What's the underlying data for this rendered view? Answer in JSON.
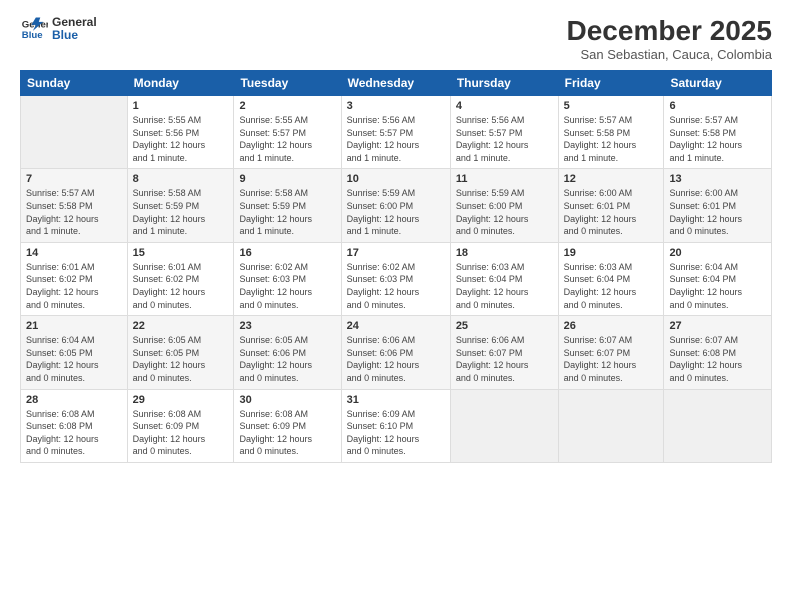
{
  "header": {
    "logo_line1": "General",
    "logo_line2": "Blue",
    "month": "December 2025",
    "location": "San Sebastian, Cauca, Colombia"
  },
  "weekdays": [
    "Sunday",
    "Monday",
    "Tuesday",
    "Wednesday",
    "Thursday",
    "Friday",
    "Saturday"
  ],
  "weeks": [
    [
      {
        "day": "",
        "info": ""
      },
      {
        "day": "1",
        "info": "Sunrise: 5:55 AM\nSunset: 5:56 PM\nDaylight: 12 hours\nand 1 minute."
      },
      {
        "day": "2",
        "info": "Sunrise: 5:55 AM\nSunset: 5:57 PM\nDaylight: 12 hours\nand 1 minute."
      },
      {
        "day": "3",
        "info": "Sunrise: 5:56 AM\nSunset: 5:57 PM\nDaylight: 12 hours\nand 1 minute."
      },
      {
        "day": "4",
        "info": "Sunrise: 5:56 AM\nSunset: 5:57 PM\nDaylight: 12 hours\nand 1 minute."
      },
      {
        "day": "5",
        "info": "Sunrise: 5:57 AM\nSunset: 5:58 PM\nDaylight: 12 hours\nand 1 minute."
      },
      {
        "day": "6",
        "info": "Sunrise: 5:57 AM\nSunset: 5:58 PM\nDaylight: 12 hours\nand 1 minute."
      }
    ],
    [
      {
        "day": "7",
        "info": "Sunrise: 5:57 AM\nSunset: 5:58 PM\nDaylight: 12 hours\nand 1 minute."
      },
      {
        "day": "8",
        "info": "Sunrise: 5:58 AM\nSunset: 5:59 PM\nDaylight: 12 hours\nand 1 minute."
      },
      {
        "day": "9",
        "info": "Sunrise: 5:58 AM\nSunset: 5:59 PM\nDaylight: 12 hours\nand 1 minute."
      },
      {
        "day": "10",
        "info": "Sunrise: 5:59 AM\nSunset: 6:00 PM\nDaylight: 12 hours\nand 1 minute."
      },
      {
        "day": "11",
        "info": "Sunrise: 5:59 AM\nSunset: 6:00 PM\nDaylight: 12 hours\nand 0 minutes."
      },
      {
        "day": "12",
        "info": "Sunrise: 6:00 AM\nSunset: 6:01 PM\nDaylight: 12 hours\nand 0 minutes."
      },
      {
        "day": "13",
        "info": "Sunrise: 6:00 AM\nSunset: 6:01 PM\nDaylight: 12 hours\nand 0 minutes."
      }
    ],
    [
      {
        "day": "14",
        "info": "Sunrise: 6:01 AM\nSunset: 6:02 PM\nDaylight: 12 hours\nand 0 minutes."
      },
      {
        "day": "15",
        "info": "Sunrise: 6:01 AM\nSunset: 6:02 PM\nDaylight: 12 hours\nand 0 minutes."
      },
      {
        "day": "16",
        "info": "Sunrise: 6:02 AM\nSunset: 6:03 PM\nDaylight: 12 hours\nand 0 minutes."
      },
      {
        "day": "17",
        "info": "Sunrise: 6:02 AM\nSunset: 6:03 PM\nDaylight: 12 hours\nand 0 minutes."
      },
      {
        "day": "18",
        "info": "Sunrise: 6:03 AM\nSunset: 6:04 PM\nDaylight: 12 hours\nand 0 minutes."
      },
      {
        "day": "19",
        "info": "Sunrise: 6:03 AM\nSunset: 6:04 PM\nDaylight: 12 hours\nand 0 minutes."
      },
      {
        "day": "20",
        "info": "Sunrise: 6:04 AM\nSunset: 6:04 PM\nDaylight: 12 hours\nand 0 minutes."
      }
    ],
    [
      {
        "day": "21",
        "info": "Sunrise: 6:04 AM\nSunset: 6:05 PM\nDaylight: 12 hours\nand 0 minutes."
      },
      {
        "day": "22",
        "info": "Sunrise: 6:05 AM\nSunset: 6:05 PM\nDaylight: 12 hours\nand 0 minutes."
      },
      {
        "day": "23",
        "info": "Sunrise: 6:05 AM\nSunset: 6:06 PM\nDaylight: 12 hours\nand 0 minutes."
      },
      {
        "day": "24",
        "info": "Sunrise: 6:06 AM\nSunset: 6:06 PM\nDaylight: 12 hours\nand 0 minutes."
      },
      {
        "day": "25",
        "info": "Sunrise: 6:06 AM\nSunset: 6:07 PM\nDaylight: 12 hours\nand 0 minutes."
      },
      {
        "day": "26",
        "info": "Sunrise: 6:07 AM\nSunset: 6:07 PM\nDaylight: 12 hours\nand 0 minutes."
      },
      {
        "day": "27",
        "info": "Sunrise: 6:07 AM\nSunset: 6:08 PM\nDaylight: 12 hours\nand 0 minutes."
      }
    ],
    [
      {
        "day": "28",
        "info": "Sunrise: 6:08 AM\nSunset: 6:08 PM\nDaylight: 12 hours\nand 0 minutes."
      },
      {
        "day": "29",
        "info": "Sunrise: 6:08 AM\nSunset: 6:09 PM\nDaylight: 12 hours\nand 0 minutes."
      },
      {
        "day": "30",
        "info": "Sunrise: 6:08 AM\nSunset: 6:09 PM\nDaylight: 12 hours\nand 0 minutes."
      },
      {
        "day": "31",
        "info": "Sunrise: 6:09 AM\nSunset: 6:10 PM\nDaylight: 12 hours\nand 0 minutes."
      },
      {
        "day": "",
        "info": ""
      },
      {
        "day": "",
        "info": ""
      },
      {
        "day": "",
        "info": ""
      }
    ]
  ]
}
